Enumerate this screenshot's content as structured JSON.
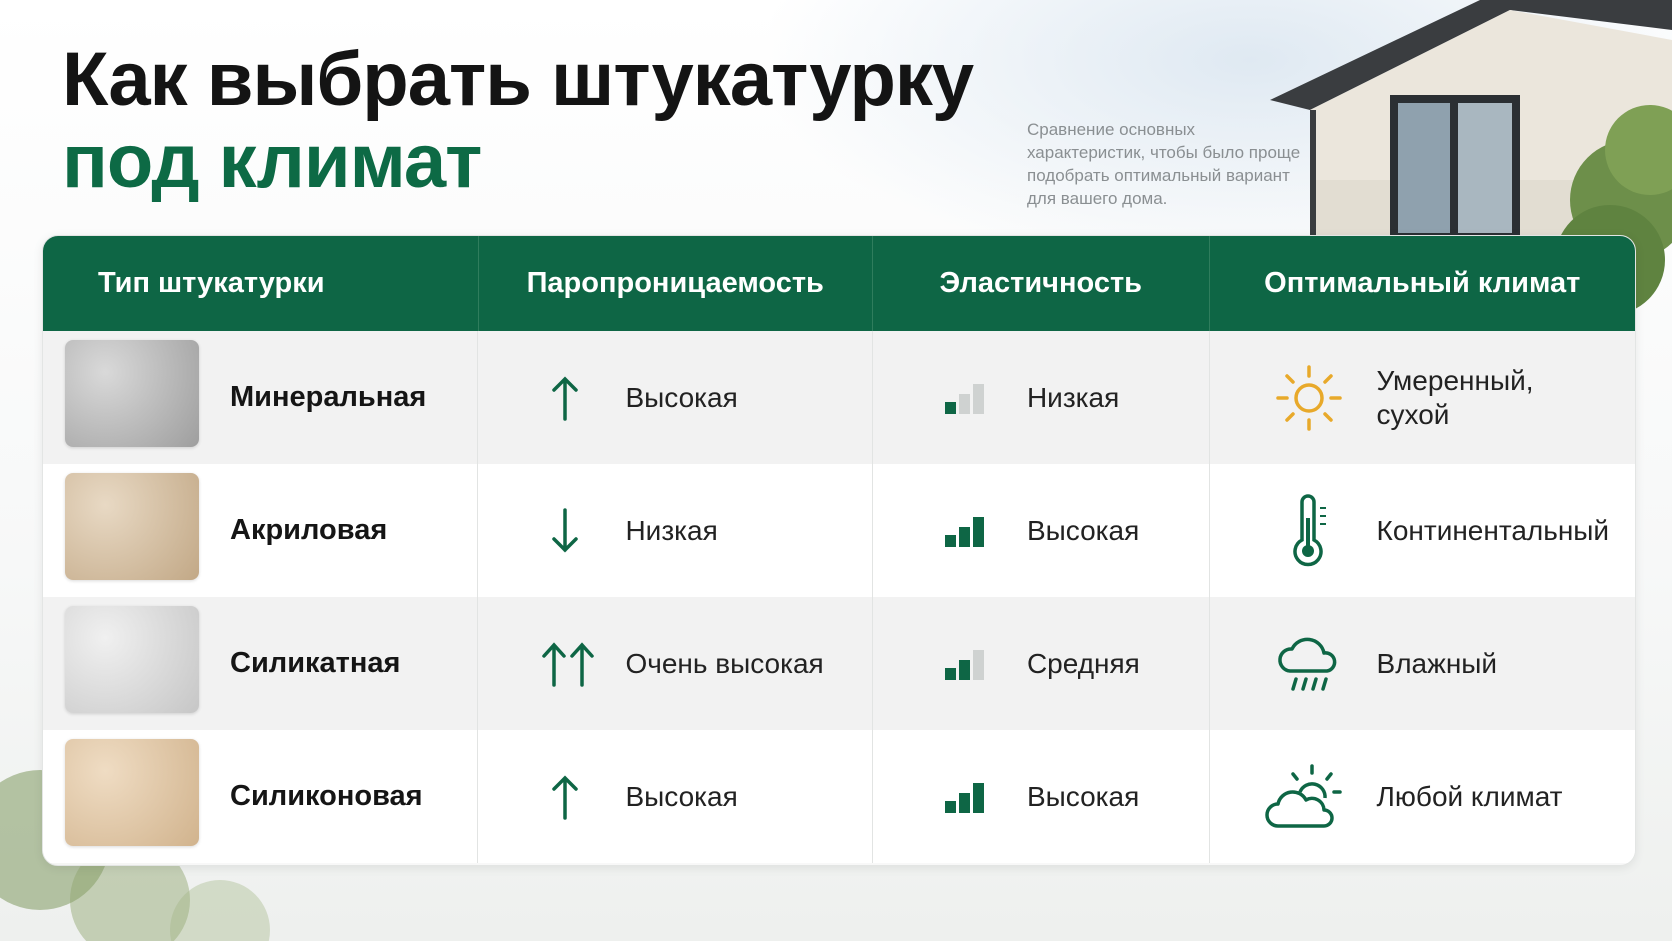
{
  "title": {
    "line1": "Как выбрать штукатурку",
    "line2": "под климат"
  },
  "subtitle": "Сравнение основных характеристик, чтобы было проще подобрать оптимальный вариант для вашего дома.",
  "colors": {
    "brand_green": "#0e6645",
    "sun_yellow": "#e8a92a",
    "bar_empty": "#cfd2d1"
  },
  "table": {
    "headers": [
      "Тип штукатурки",
      "Паропроницаемость",
      "Эластичность",
      "Оптимальный климат"
    ],
    "rows": [
      {
        "type": "Минеральная",
        "swatch_color": "#bdbdbd",
        "vapor": "Высокая",
        "vapor_icon": "arrow-up-icon",
        "elasticity": "Низкая",
        "elasticity_level": 1,
        "climate": "Умеренный, сухой",
        "climate_icon": "sun-icon"
      },
      {
        "type": "Акриловая",
        "swatch_color": "#d8c4aa",
        "vapor": "Низкая",
        "vapor_icon": "arrow-down-icon",
        "elasticity": "Высокая",
        "elasticity_level": 3,
        "climate": "Континентальный",
        "climate_icon": "thermometer-icon"
      },
      {
        "type": "Силикатная",
        "swatch_color": "#dcdcdc",
        "vapor": "Очень высокая",
        "vapor_icon": "double-arrow-up-icon",
        "elasticity": "Средняя",
        "elasticity_level": 2,
        "climate": "Влажный",
        "climate_icon": "rain-cloud-icon"
      },
      {
        "type": "Силиконовая",
        "swatch_color": "#e3c9a8",
        "vapor": "Высокая",
        "vapor_icon": "arrow-up-icon",
        "elasticity": "Высокая",
        "elasticity_level": 3,
        "climate": "Любой климат",
        "climate_icon": "sun-cloud-icon"
      }
    ]
  }
}
